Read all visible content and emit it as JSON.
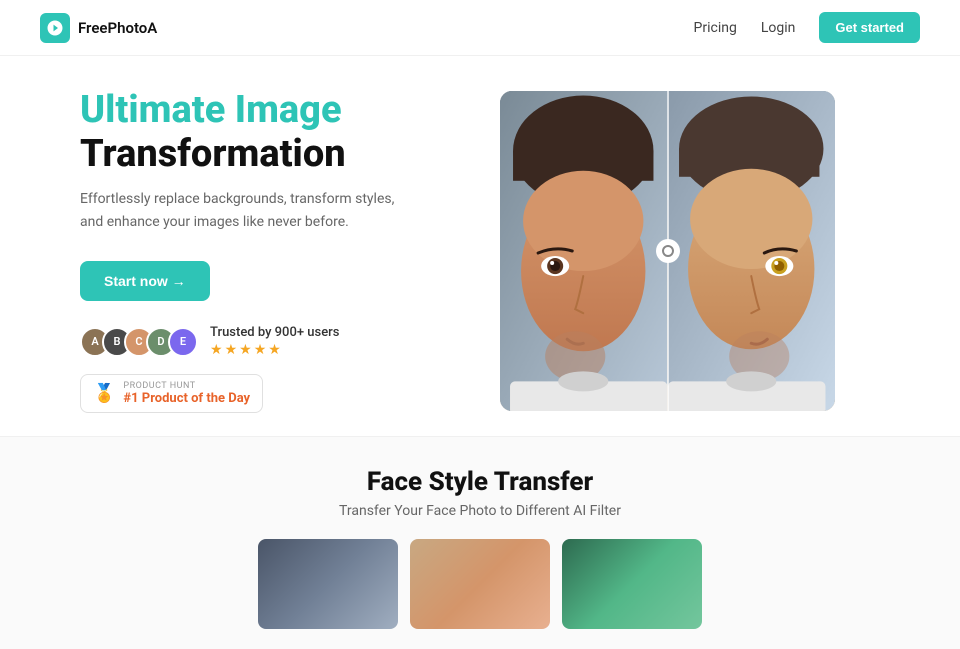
{
  "nav": {
    "logo_text": "FreePhotoA",
    "links": [
      {
        "label": "Pricing",
        "id": "pricing"
      },
      {
        "label": "Login",
        "id": "login"
      }
    ],
    "cta_label": "Get started"
  },
  "hero": {
    "title_accent": "Ultimate Image",
    "title_normal": "Transformation",
    "subtitle": "Effortlessly replace backgrounds, transform styles, and enhance your images like never before.",
    "cta_label": "Start now →",
    "trust_label": "Trusted by 900+ users",
    "stars": [
      "★",
      "★",
      "★",
      "★",
      "★"
    ],
    "ph_label": "PRODUCT HUNT",
    "ph_rank": "#1 Product of the Day"
  },
  "bottom": {
    "title": "Face Style Transfer",
    "subtitle": "Transfer Your Face Photo to Different AI Filter"
  }
}
